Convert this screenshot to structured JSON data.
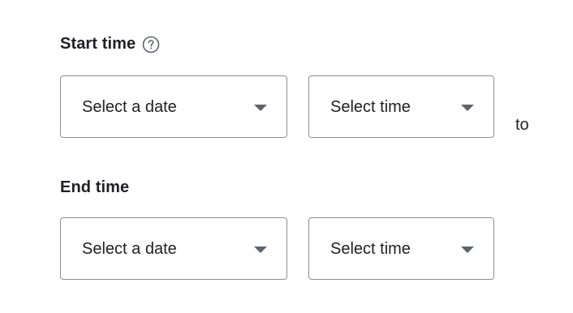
{
  "start": {
    "label": "Start time",
    "help_icon": "help-circle-icon",
    "date_value": "Select a date",
    "time_value": "Select time"
  },
  "connector": {
    "label": "to"
  },
  "end": {
    "label": "End time",
    "date_value": "Select a date",
    "time_value": "Select time"
  },
  "colors": {
    "text": "#202124",
    "border": "#8f8f8f",
    "caret": "#5f6368",
    "help_icon": "#5f6368"
  }
}
